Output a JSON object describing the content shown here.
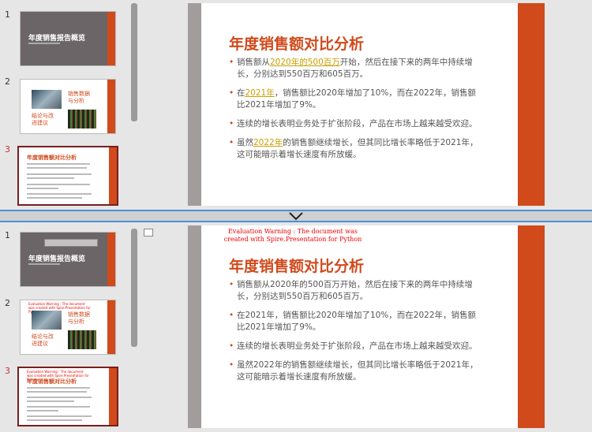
{
  "top": {
    "thumbnails": [
      {
        "num": "1",
        "title": "年度销售报告概览"
      },
      {
        "num": "2",
        "label1": "销售数据\n与分析",
        "label2": "结论与改\n进建议"
      },
      {
        "num": "3",
        "title": "年度销售额对比分析"
      }
    ],
    "slide": {
      "title": "年度销售额对比分析",
      "bullets": [
        {
          "pre": "销售额从",
          "hl": "2020年的500百万",
          "post": "开始，然后在接下来的两年中持续增长，分别达到550百万和605百万。"
        },
        {
          "pre": "在",
          "hl": "2021年",
          "post": "，销售额比2020年增加了10%，而在2022年，销售额比2021年增加了9%。"
        },
        {
          "pre": "",
          "hl": "",
          "post": "连续的增长表明业务处于扩张阶段，产品在市场上越来越受欢迎。"
        },
        {
          "pre": "虽然",
          "hl": "2022年",
          "post": "的销售额继续增长，但其同比增长率略低于2021年，这可能暗示着增长速度有所放缓。"
        }
      ]
    }
  },
  "bottom": {
    "thumbnails": [
      {
        "num": "1",
        "title": "年度销售报告概览"
      },
      {
        "num": "2",
        "label1": "销售数据\n与分析",
        "label2": "结论与改\n进建议"
      },
      {
        "num": "3",
        "title": "年度销售额对比分析"
      }
    ],
    "watermark": "Evaluation Warning : The document was created with Spire.Presentation for Python",
    "slide": {
      "title": "年度销售额对比分析",
      "bullets": [
        "销售额从2020年的500百万开始，然后在接下来的两年中持续增长，分别达到550百万和605百万。",
        "在2021年，销售额比2020年增加了10%，而在2022年，销售额比2021年增加了9%。",
        "连续的增长表明业务处于扩张阶段，产品在市场上越来越受欢迎。",
        "虽然2022年的销售额继续增长，但其同比增长率略低于2021年，这可能暗示着增长速度有所放缓。"
      ]
    }
  },
  "colors": {
    "accent": "#d04a1c",
    "highlight": "#c8a000",
    "frame": "#4a90d9"
  },
  "icons": {
    "divider": "chevron-down-icon"
  }
}
